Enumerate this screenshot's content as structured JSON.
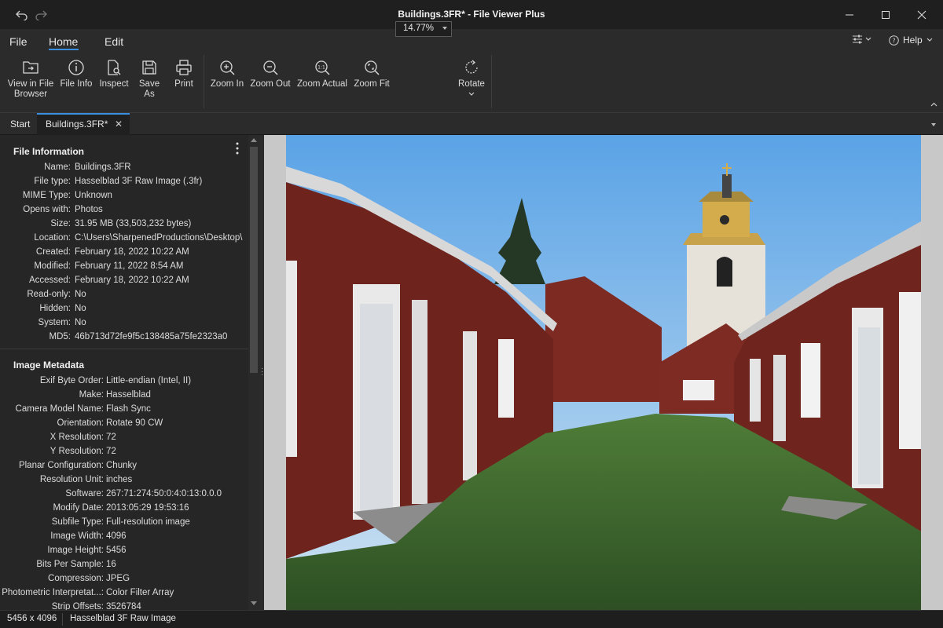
{
  "window": {
    "title": "Buildings.3FR* - File Viewer Plus"
  },
  "menu": {
    "file": "File",
    "home": "Home",
    "edit": "Edit",
    "help": "Help"
  },
  "ribbon": {
    "view_in_browser_line1": "View in File",
    "view_in_browser_line2": "Browser",
    "file_info": "File Info",
    "inspect": "Inspect",
    "save_as": "Save As",
    "print": "Print",
    "zoom_in": "Zoom In",
    "zoom_out": "Zoom Out",
    "zoom_actual": "Zoom Actual",
    "zoom_fit": "Zoom Fit",
    "zoom_level": "14.77%",
    "rotate": "Rotate"
  },
  "tabs": {
    "start": "Start",
    "active": "Buildings.3FR*"
  },
  "file_information": {
    "title": "File Information",
    "rows": [
      {
        "k": "Name:",
        "v": "Buildings.3FR"
      },
      {
        "k": "File type:",
        "v": "Hasselblad 3F Raw Image (.3fr)"
      },
      {
        "k": "MIME Type:",
        "v": "Unknown"
      },
      {
        "k": "Opens with:",
        "v": "Photos"
      },
      {
        "k": "Size:",
        "v": "31.95 MB (33,503,232 bytes)"
      },
      {
        "k": "Location:",
        "v": "C:\\Users\\SharpenedProductions\\Desktop\\"
      },
      {
        "k": "Created:",
        "v": "February 18, 2022 10:22 AM"
      },
      {
        "k": "Modified:",
        "v": "February 11, 2022 8:54 AM"
      },
      {
        "k": "Accessed:",
        "v": "February 18, 2022 10:22 AM"
      },
      {
        "k": "Read-only:",
        "v": "No"
      },
      {
        "k": "Hidden:",
        "v": "No"
      },
      {
        "k": "System:",
        "v": "No"
      },
      {
        "k": "MD5:",
        "v": "46b713d72fe9f5c138485a75fe2323a0"
      }
    ]
  },
  "image_metadata": {
    "title": "Image Metadata",
    "rows": [
      {
        "k": "Exif Byte Order:",
        "v": "Little-endian (Intel, II)"
      },
      {
        "k": "Make:",
        "v": "Hasselblad"
      },
      {
        "k": "Camera Model Name:",
        "v": "Flash Sync"
      },
      {
        "k": "Orientation:",
        "v": "Rotate 90 CW"
      },
      {
        "k": "X Resolution:",
        "v": "72"
      },
      {
        "k": "Y Resolution:",
        "v": "72"
      },
      {
        "k": "Planar Configuration:",
        "v": "Chunky"
      },
      {
        "k": "Resolution Unit:",
        "v": "inches"
      },
      {
        "k": "Software:",
        "v": "267:71:274:50:0:4:0:13:0.0.0"
      },
      {
        "k": "Modify Date:",
        "v": "2013:05:29 19:53:16"
      },
      {
        "k": "Subfile Type:",
        "v": "Full-resolution image"
      },
      {
        "k": "Image Width:",
        "v": "4096"
      },
      {
        "k": "Image Height:",
        "v": "5456"
      },
      {
        "k": "Bits Per Sample:",
        "v": "16"
      },
      {
        "k": "Compression:",
        "v": "JPEG"
      },
      {
        "k": "Photometric Interpretat...:",
        "v": "Color Filter Array"
      },
      {
        "k": "Strip Offsets:",
        "v": "3526784"
      }
    ]
  },
  "status": {
    "dimensions": "5456 x 4096",
    "type": "Hasselblad 3F Raw Image"
  }
}
